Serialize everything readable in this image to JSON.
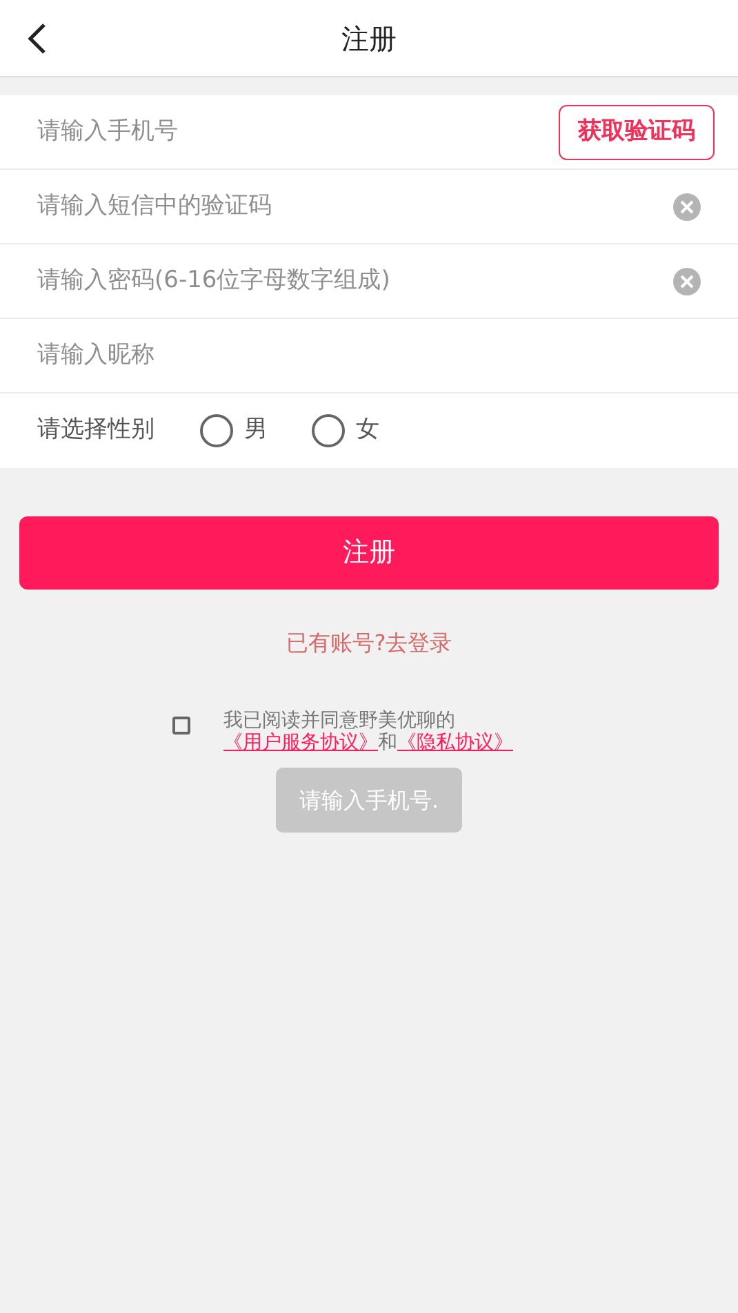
{
  "header": {
    "title": "注册"
  },
  "fields": [
    {
      "kind": "phone",
      "placeholder": "请输入手机号",
      "button": "获取验证码"
    },
    {
      "kind": "clearable",
      "placeholder": "请输入短信中的验证码"
    },
    {
      "kind": "clearable",
      "placeholder": "请输入密码(6-16位字母数字组成)"
    },
    {
      "kind": "plain",
      "placeholder": "请输入昵称"
    }
  ],
  "gender": {
    "label": "请选择性别",
    "options": [
      {
        "label": "男",
        "selected": false
      },
      {
        "label": "女",
        "selected": false
      }
    ]
  },
  "register_button": "注册",
  "login_link": "已有账号?去登录",
  "agreement": {
    "checked": false,
    "text": "我已阅读并同意野美优聊的",
    "link_1": "《用户服务协议》",
    "joiner": "和",
    "link_2": "《隐私协议》"
  },
  "toast": "请输入手机号."
}
